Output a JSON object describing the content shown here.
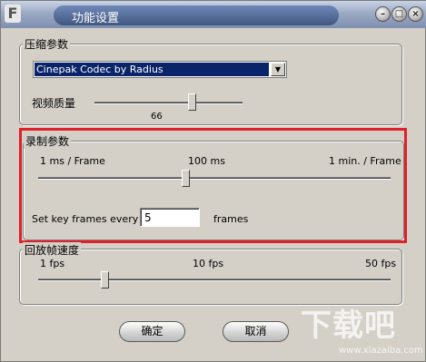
{
  "window": {
    "title": "功能设置",
    "icon_glyph": "F",
    "controls": {
      "minimize": "–",
      "maximize": "□",
      "close": "×"
    }
  },
  "compression": {
    "group_label": "压缩参数",
    "codec": {
      "selected": "Cinepak Codec by Radius",
      "arrow": "▼"
    },
    "quality_label": "视频质量",
    "quality_value": "66"
  },
  "recording": {
    "group_label": "录制参数",
    "tick_min": "1 ms / Frame",
    "tick_mid": "100 ms",
    "tick_max": "1 min. / Frame",
    "keyframe_prefix": "Set key frames every",
    "keyframe_value": "5",
    "keyframe_suffix": "frames"
  },
  "playback": {
    "group_label": "回放帧速度",
    "tick_min": "1 fps",
    "tick_mid": "10 fps",
    "tick_max": "50 fps"
  },
  "buttons": {
    "ok": "确定",
    "cancel": "取消"
  },
  "watermark": {
    "text": "下载吧",
    "url": "www.xiazaiba.com"
  },
  "colors": {
    "highlight": "#e0202a",
    "selection": "#0a246a"
  }
}
